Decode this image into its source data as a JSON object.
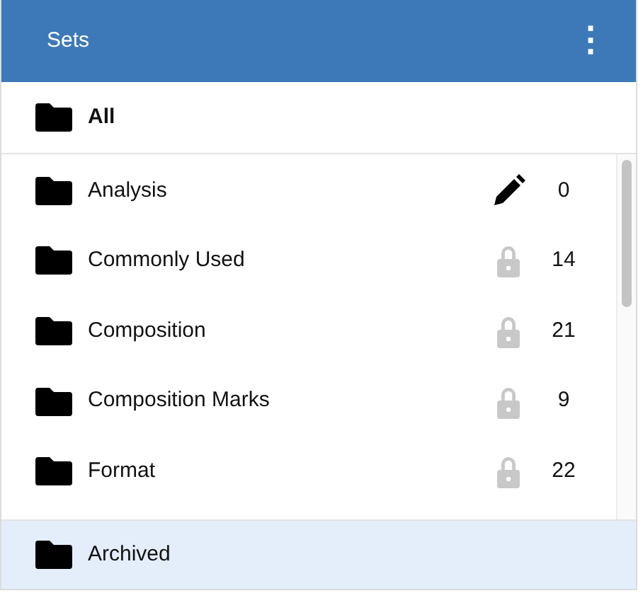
{
  "header": {
    "title": "Sets",
    "menu_icon": "⋮"
  },
  "all": {
    "label": "All",
    "selected": false
  },
  "sets": [
    {
      "name": "Analysis",
      "kind": "editable",
      "count": "0"
    },
    {
      "name": "Commonly Used",
      "kind": "locked",
      "count": "14"
    },
    {
      "name": "Composition",
      "kind": "locked",
      "count": "21"
    },
    {
      "name": "Composition Marks",
      "kind": "locked",
      "count": "9"
    },
    {
      "name": "Format",
      "kind": "locked",
      "count": "22"
    }
  ],
  "archived": {
    "label": "Archived",
    "selected": true
  }
}
